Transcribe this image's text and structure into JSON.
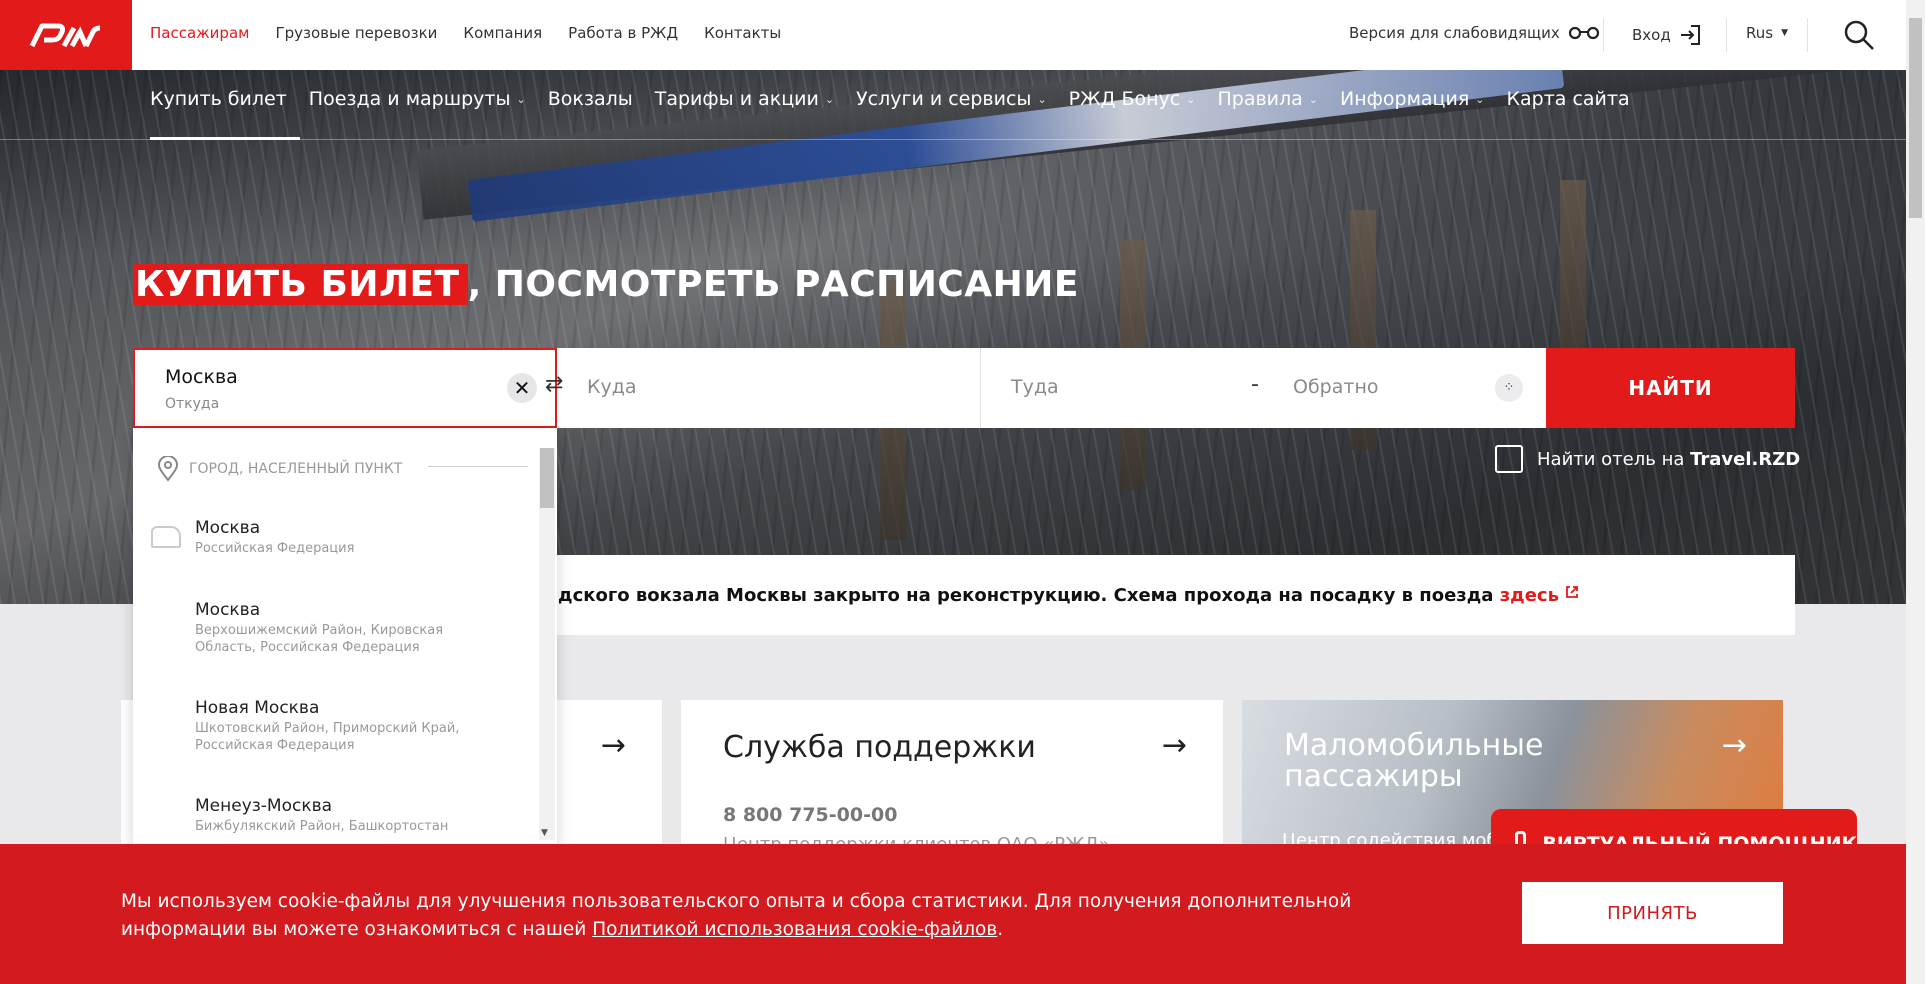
{
  "header": {
    "logo_text": "РЖД",
    "nav": [
      {
        "label": "Пассажирам",
        "active": true
      },
      {
        "label": "Грузовые перевозки"
      },
      {
        "label": "Компания"
      },
      {
        "label": "Работа в РЖД"
      },
      {
        "label": "Контакты"
      }
    ],
    "accessibility_label": "Версия для слабовидящих",
    "login_label": "Вход",
    "lang_label": "Rus"
  },
  "main_nav": [
    {
      "label": "Купить билет",
      "chevron": false
    },
    {
      "label": "Поезда и маршруты",
      "chevron": true
    },
    {
      "label": "Вокзалы",
      "chevron": false
    },
    {
      "label": "Тарифы и акции",
      "chevron": true
    },
    {
      "label": "Услуги и сервисы",
      "chevron": true
    },
    {
      "label": "РЖД Бонус",
      "chevron": true
    },
    {
      "label": "Правила",
      "chevron": true
    },
    {
      "label": "Информация",
      "chevron": true
    },
    {
      "label": "Карта сайта",
      "chevron": false
    }
  ],
  "headline": {
    "highlight": "КУПИТЬ БИЛЕТ",
    "rest": ", ПОСМОТРЕТЬ РАСПИСАНИЕ"
  },
  "search": {
    "from_value": "Москва",
    "from_label": "Откуда",
    "to_placeholder": "Куда",
    "there_placeholder": "Туда",
    "dash": "-",
    "back_placeholder": "Обратно",
    "find_label": "НАЙТИ"
  },
  "hotel": {
    "prefix": "Найти отель на ",
    "brand": "Travel.RZD"
  },
  "notice": {
    "text": "радского вокзала Москвы закрыто на реконструкцию. Схема прохода на посадку в поезда ",
    "link": "здесь"
  },
  "dropdown": {
    "header": "ГОРОД, НАСЕЛЕННЫЙ ПУНКТ",
    "items": [
      {
        "name": "Москва",
        "desc": "Российская Федерация"
      },
      {
        "name": "Москва",
        "desc": "Верхошижемский Район, Кировская Область, Российская Федерация"
      },
      {
        "name": "Новая Москва",
        "desc": "Шкотовский Район, Приморский Край, Российская Федерация"
      },
      {
        "name": "Менеуз-Москва",
        "desc": "Бижбулякский Район, Башкортостан"
      }
    ]
  },
  "cards": {
    "support_title": "Служба поддержки",
    "support_phone": "8 800 775-00-00",
    "support_sub": "Центр поддержки клиентов ОАО «РЖД»",
    "mobility_title": "Маломобильные пассажиры",
    "mobility_sub": "Центр содействия моб"
  },
  "assistant_label": "ВИРТУАЛЬНЫЙ ПОМОЩНИК",
  "cookie": {
    "text": "Мы используем cookie-файлы для улучшения пользовательского опыта и сбора статистики. Для получения дополнительной информации вы можете ознакомиться с нашей ",
    "link": "Политикой использования cookie-файлов",
    "end": ".",
    "accept": "ПРИНЯТЬ"
  },
  "colors": {
    "brand_red": "#e21a1a",
    "cookie_red": "#d21a1f"
  }
}
